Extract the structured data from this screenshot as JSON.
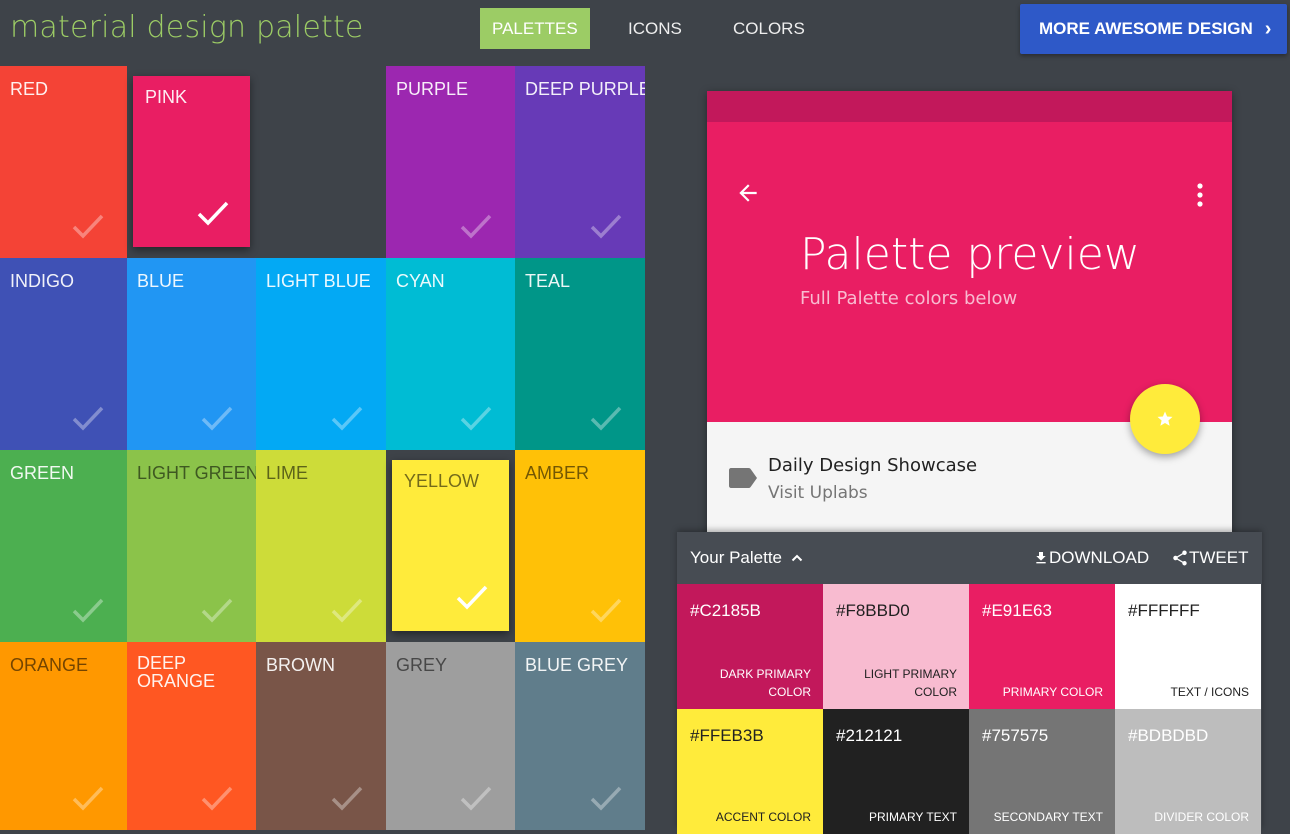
{
  "header": {
    "logo": "material design palette",
    "nav": [
      "PALETTES",
      "ICONS",
      "COLORS"
    ],
    "cta": "MORE AWESOME DESIGN"
  },
  "palettes": [
    {
      "name": "RED",
      "color": "#f44336"
    },
    {
      "name": "PINK",
      "color": "#e91e63",
      "selected": true
    },
    {
      "name": "PURPLE",
      "color": "#9c27b0"
    },
    {
      "name": "DEEP PURPLE",
      "color": "#673ab7"
    },
    {
      "name": "INDIGO",
      "color": "#3f51b5"
    },
    {
      "name": "BLUE",
      "color": "#2196f3"
    },
    {
      "name": "LIGHT BLUE",
      "color": "#03a9f4"
    },
    {
      "name": "CYAN",
      "color": "#00bcd4"
    },
    {
      "name": "TEAL",
      "color": "#009688"
    },
    {
      "name": "GREEN",
      "color": "#4caf50"
    },
    {
      "name": "LIGHT GREEN",
      "color": "#8bc34a"
    },
    {
      "name": "LIME",
      "color": "#cddc39"
    },
    {
      "name": "YELLOW",
      "color": "#ffeb3b",
      "selected": true
    },
    {
      "name": "AMBER",
      "color": "#ffc107"
    },
    {
      "name": "ORANGE",
      "color": "#ff9800"
    },
    {
      "name": "DEEP ORANGE",
      "color": "#ff5722"
    },
    {
      "name": "BROWN",
      "color": "#795548"
    },
    {
      "name": "GREY",
      "color": "#9e9e9e"
    },
    {
      "name": "BLUE GREY",
      "color": "#607d8b"
    }
  ],
  "preview": {
    "title": "Palette preview",
    "subtitle": "Full Palette colors below",
    "item_title": "Daily Design Showcase",
    "item_subtitle": "Visit Uplabs"
  },
  "panel": {
    "title": "Your Palette",
    "download": "DOWNLOAD",
    "tweet": "TWEET",
    "swatches": [
      {
        "hex": "#C2185B",
        "label": "DARK PRIMARY COLOR",
        "bg": "#c2185b",
        "fg": "#ffffff"
      },
      {
        "hex": "#F8BBD0",
        "label": "LIGHT PRIMARY COLOR",
        "bg": "#f8bbd0",
        "fg": "#212121"
      },
      {
        "hex": "#E91E63",
        "label": "PRIMARY COLOR",
        "bg": "#e91e63",
        "fg": "#ffffff"
      },
      {
        "hex": "#FFFFFF",
        "label": "TEXT / ICONS",
        "bg": "#ffffff",
        "fg": "#212121"
      },
      {
        "hex": "#FFEB3B",
        "label": "ACCENT COLOR",
        "bg": "#ffeb3b",
        "fg": "#212121"
      },
      {
        "hex": "#212121",
        "label": "PRIMARY TEXT",
        "bg": "#212121",
        "fg": "#ffffff"
      },
      {
        "hex": "#757575",
        "label": "SECONDARY TEXT",
        "bg": "#757575",
        "fg": "#ffffff"
      },
      {
        "hex": "#BDBDBD",
        "label": "DIVIDER COLOR",
        "bg": "#bdbdbd",
        "fg": "#ffffff"
      }
    ]
  }
}
